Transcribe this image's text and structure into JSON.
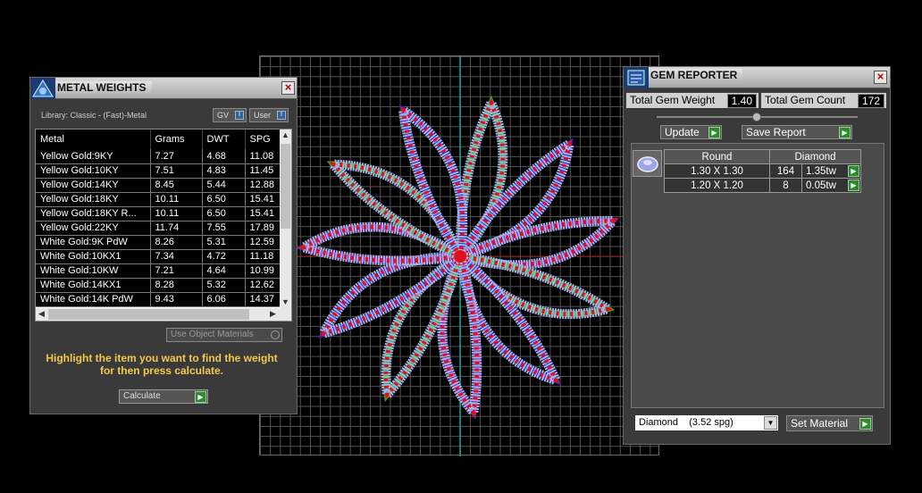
{
  "metal_weights": {
    "title": "METAL WEIGHTS",
    "library": "Library: Classic - (Fast)-Metal",
    "gv_label": "GV",
    "user_label": "User",
    "columns": [
      "Metal",
      "Grams",
      "DWT",
      "SPG"
    ],
    "rows": [
      [
        "Yellow Gold:9KY",
        "7.27",
        "4.68",
        "11.08"
      ],
      [
        "Yellow Gold:10KY",
        "7.51",
        "4.83",
        "11.45"
      ],
      [
        "Yellow Gold:14KY",
        "8.45",
        "5.44",
        "12.88"
      ],
      [
        "Yellow Gold:18KY",
        "10.11",
        "6.50",
        "15.41"
      ],
      [
        "Yellow Gold:18KY R...",
        "10.11",
        "6.50",
        "15.41"
      ],
      [
        "Yellow Gold:22KY",
        "11.74",
        "7.55",
        "17.89"
      ],
      [
        "White Gold:9K PdW",
        "8.26",
        "5.31",
        "12.59"
      ],
      [
        "White Gold:10KX1",
        "7.34",
        "4.72",
        "11.18"
      ],
      [
        "White Gold:10KW",
        "7.21",
        "4.64",
        "10.99"
      ],
      [
        "White Gold:14KX1",
        "8.28",
        "5.32",
        "12.62"
      ],
      [
        "White Gold:14K PdW",
        "9.43",
        "6.06",
        "14.37"
      ]
    ],
    "use_object_materials": "Use Object Materials",
    "hint": "Highlight the item you want to find the weight for then press calculate.",
    "calculate_label": "Calculate"
  },
  "gem_reporter": {
    "title": "GEM REPORTER",
    "total_weight_label": "Total Gem Weight",
    "total_weight_value": "1.40",
    "total_count_label": "Total Gem Count",
    "total_count_value": "172",
    "update_label": "Update",
    "save_report_label": "Save Report",
    "table_headers": [
      "Round",
      "Diamond"
    ],
    "table_rows": [
      [
        "1.30 X 1.30",
        "164",
        "1.35tw"
      ],
      [
        "1.20 X 1.20",
        "8",
        "0.05tw"
      ]
    ],
    "material_selected": "Diamond    (3.52 spg)",
    "set_material_label": "Set Material"
  },
  "colors": {
    "accent_green": "#2e8b2e",
    "hint_yellow": "#f2c94c",
    "petal_red": "#e0101a",
    "gem_fill": "#a8b0ee",
    "curve_blue": "#1a2ad8",
    "curve_green": "#22c022",
    "curve_purple": "#7a2aa8"
  }
}
